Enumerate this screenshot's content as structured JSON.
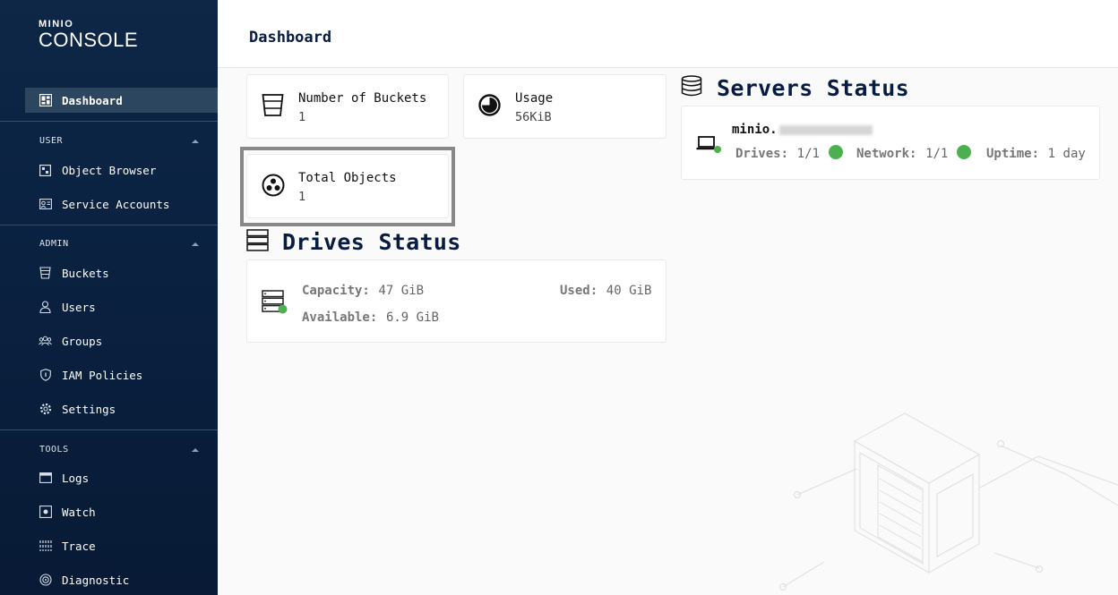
{
  "app": {
    "logo_small": "MINIO",
    "logo_big": "CONSOLE"
  },
  "sidebar": {
    "dashboard_label": "Dashboard",
    "sections": [
      {
        "title": "USER",
        "items": [
          {
            "label": "Object Browser",
            "icon": "object-browser-icon"
          },
          {
            "label": "Service Accounts",
            "icon": "service-accounts-icon"
          }
        ]
      },
      {
        "title": "ADMIN",
        "items": [
          {
            "label": "Buckets",
            "icon": "bucket-icon"
          },
          {
            "label": "Users",
            "icon": "user-icon"
          },
          {
            "label": "Groups",
            "icon": "groups-icon"
          },
          {
            "label": "IAM Policies",
            "icon": "shield-icon"
          },
          {
            "label": "Settings",
            "icon": "gear-icon"
          }
        ]
      },
      {
        "title": "TOOLS",
        "items": [
          {
            "label": "Logs",
            "icon": "logs-icon"
          },
          {
            "label": "Watch",
            "icon": "watch-icon"
          },
          {
            "label": "Trace",
            "icon": "trace-icon"
          },
          {
            "label": "Diagnostic",
            "icon": "diagnostic-icon"
          }
        ]
      }
    ]
  },
  "header": {
    "title": "Dashboard"
  },
  "stats": {
    "buckets": {
      "label": "Number of Buckets",
      "value": "1"
    },
    "usage": {
      "label": "Usage",
      "value": "56KiB"
    },
    "objects": {
      "label": "Total Objects",
      "value": "1"
    }
  },
  "servers": {
    "heading": "Servers Status",
    "server": {
      "name": "minio.",
      "drives_label": "Drives:",
      "drives_value": "1/1",
      "network_label": "Network:",
      "network_value": "1/1",
      "uptime_label": "Uptime:",
      "uptime_value": "1 day"
    }
  },
  "drives": {
    "heading": "Drives Status",
    "capacity_label": "Capacity:",
    "capacity_value": "47 GiB",
    "used_label": "Used:",
    "used_value": "40 GiB",
    "available_label": "Available:",
    "available_value": "6.9 GiB"
  },
  "colors": {
    "sidebar_bg": "#0a2140",
    "heading": "#081c42",
    "status_ok": "#4caf50"
  }
}
